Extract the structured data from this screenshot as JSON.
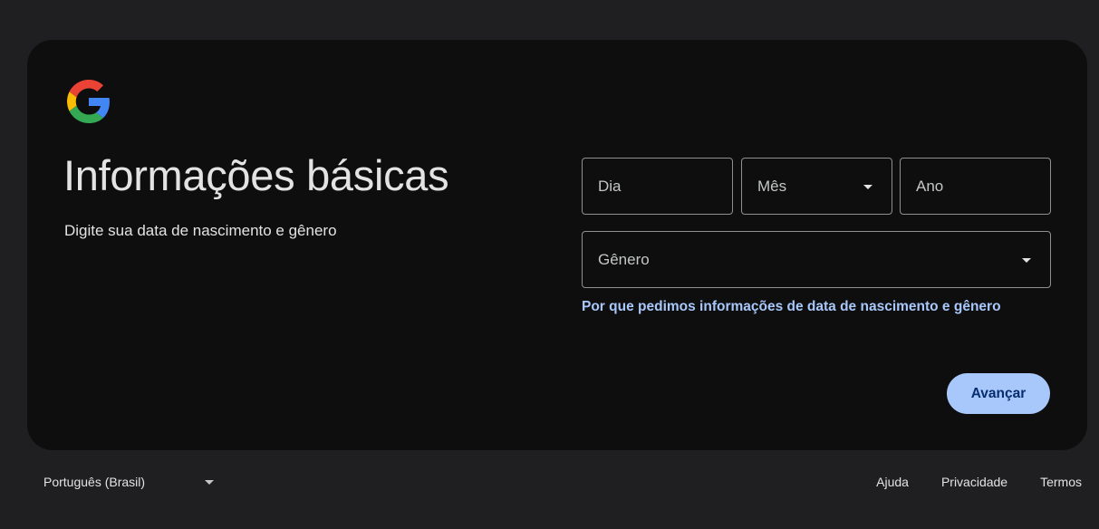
{
  "header": {
    "logo_icon": "google-g-icon"
  },
  "main": {
    "title": "Informações básicas",
    "subtitle": "Digite sua data de nascimento e gênero"
  },
  "form": {
    "day": {
      "label": "Dia",
      "value": ""
    },
    "month": {
      "label": "Mês",
      "selected": ""
    },
    "year": {
      "label": "Ano",
      "value": ""
    },
    "gender": {
      "label": "Gênero",
      "selected": ""
    },
    "why_link": "Por que pedimos informações de data de nascimento e gênero",
    "next_label": "Avançar"
  },
  "footer": {
    "language": "Português (Brasil)",
    "links": [
      "Ajuda",
      "Privacidade",
      "Termos"
    ]
  },
  "colors": {
    "page_bg": "#1f1f21",
    "card_bg": "#0e0e0f",
    "accent": "#a8c7fa",
    "button_text": "#062e6f",
    "field_border": "#8e918f"
  }
}
